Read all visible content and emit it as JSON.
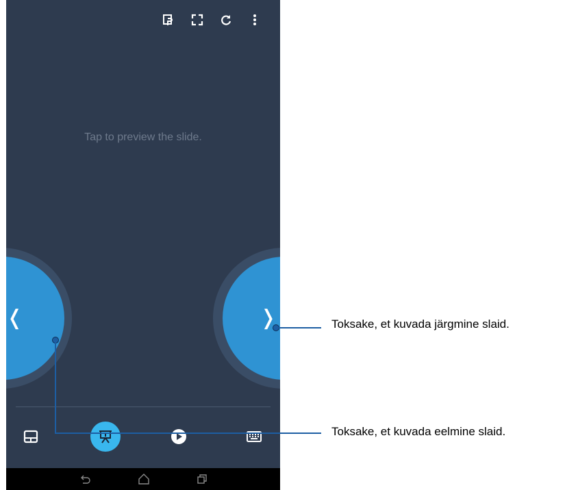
{
  "topbar": {
    "icons": [
      "presentation-mode-icon",
      "fullscreen-icon",
      "refresh-icon",
      "more-vert-icon"
    ]
  },
  "main": {
    "hint": "Tap to preview the slide."
  },
  "slide_nav": {
    "prev_glyph": "❬",
    "next_glyph": "❭"
  },
  "bottombar": {
    "icons": [
      "touchpad-icon",
      "presentation-icon",
      "play-icon",
      "keyboard-icon"
    ],
    "active": "presentation-icon"
  },
  "navbar": {
    "icons": [
      "back-icon",
      "home-icon",
      "recents-icon"
    ]
  },
  "callouts": {
    "next": "Toksake, et kuvada järgmine slaid.",
    "prev": "Toksake, et kuvada eelmine slaid."
  },
  "colors": {
    "background": "#2e3b4f",
    "button": "#2f93d3",
    "active": "#39b7ee",
    "callout_line": "#1d5ea3"
  }
}
